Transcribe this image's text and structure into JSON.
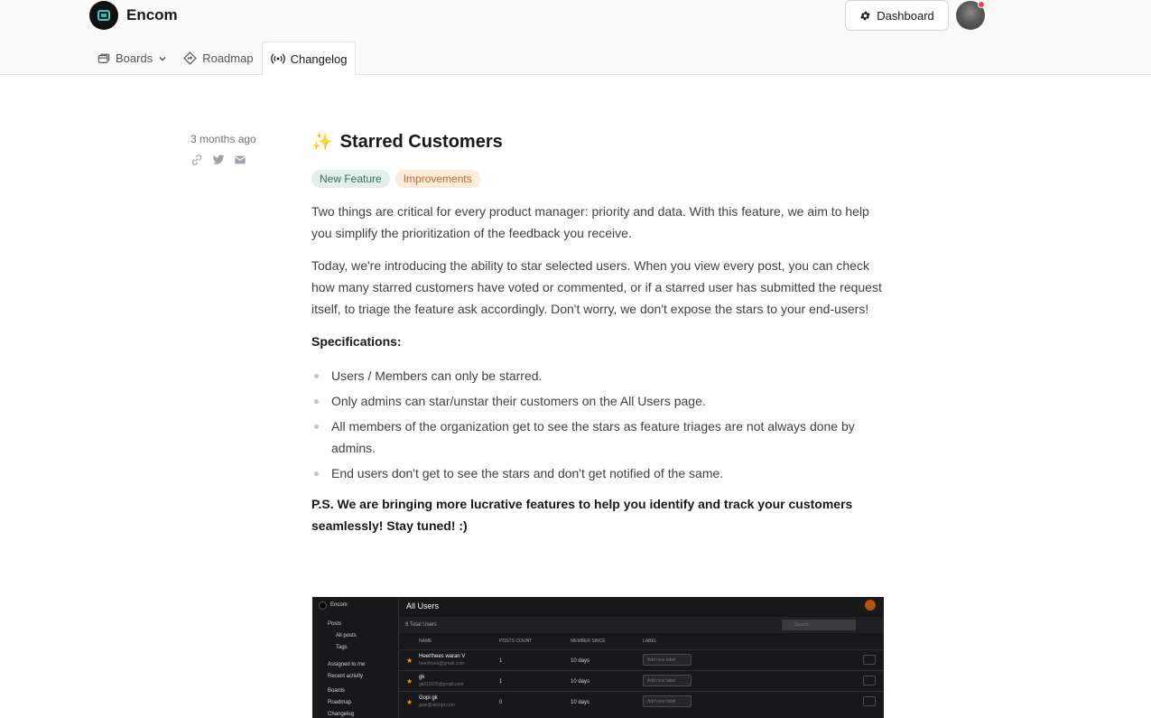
{
  "brand": {
    "name": "Encom"
  },
  "header": {
    "dashboard_label": "Dashboard"
  },
  "tabs": [
    {
      "label": "Boards",
      "icon": "boards-icon",
      "active": false
    },
    {
      "label": "Roadmap",
      "icon": "roadmap-icon",
      "active": false
    },
    {
      "label": "Changelog",
      "icon": "broadcast-icon",
      "active": true
    }
  ],
  "post": {
    "date": "3 months ago",
    "emoji": "✨",
    "title": "Starred Customers",
    "tags": [
      "New Feature",
      "Improvements"
    ],
    "paragraphs": [
      "Two things are critical for every product manager: priority and data. With this feature, we aim to help you simplify the prioritization of the feedback you receive.",
      "Today, we're introducing the ability to star selected users. When you view every post, you can check how many starred customers have voted or commented, or if a starred user has submitted the request itself, to triage the feature ask accordingly. Don't worry, we don't expose the stars to your end-users!"
    ],
    "specs_heading": "Specifications:",
    "specs": [
      "Users / Members can only be starred.",
      "Only admins can star/unstar their customers on the All Users page.",
      "All members of the organization get to see the stars as feature triages are not always done by admins.",
      "End users don't get to see the stars and don't get notified of the same."
    ],
    "ps": "P.S.  We are bringing more lucrative features to help you identify and track your customers seamlessly! Stay tuned! :)"
  },
  "screenshot": {
    "brand": "Encom",
    "title": "All Users",
    "total": "8 Total Users",
    "search_placeholder": "Search",
    "sidebar": [
      "Posts",
      "All posts",
      "Tags",
      "Assigned to me",
      "Recent activity",
      "Boards",
      "Roadmap",
      "Changelog"
    ],
    "columns": [
      "NAME",
      "POSTS COUNT",
      "MEMBER SINCE",
      "LABEL"
    ],
    "rows": [
      {
        "name": "Heerthees waran V",
        "email": "heerthees@gmail.com",
        "posts": "1",
        "since": "10 days",
        "label": "Add new label"
      },
      {
        "name": "gk",
        "email": "gk011535@gmail.com",
        "posts": "1",
        "since": "10 days",
        "label": "Add new label"
      },
      {
        "name": "Gopi gk",
        "email": "gopi@skcript.com",
        "posts": "0",
        "since": "10 days",
        "label": "Add new label"
      }
    ]
  }
}
